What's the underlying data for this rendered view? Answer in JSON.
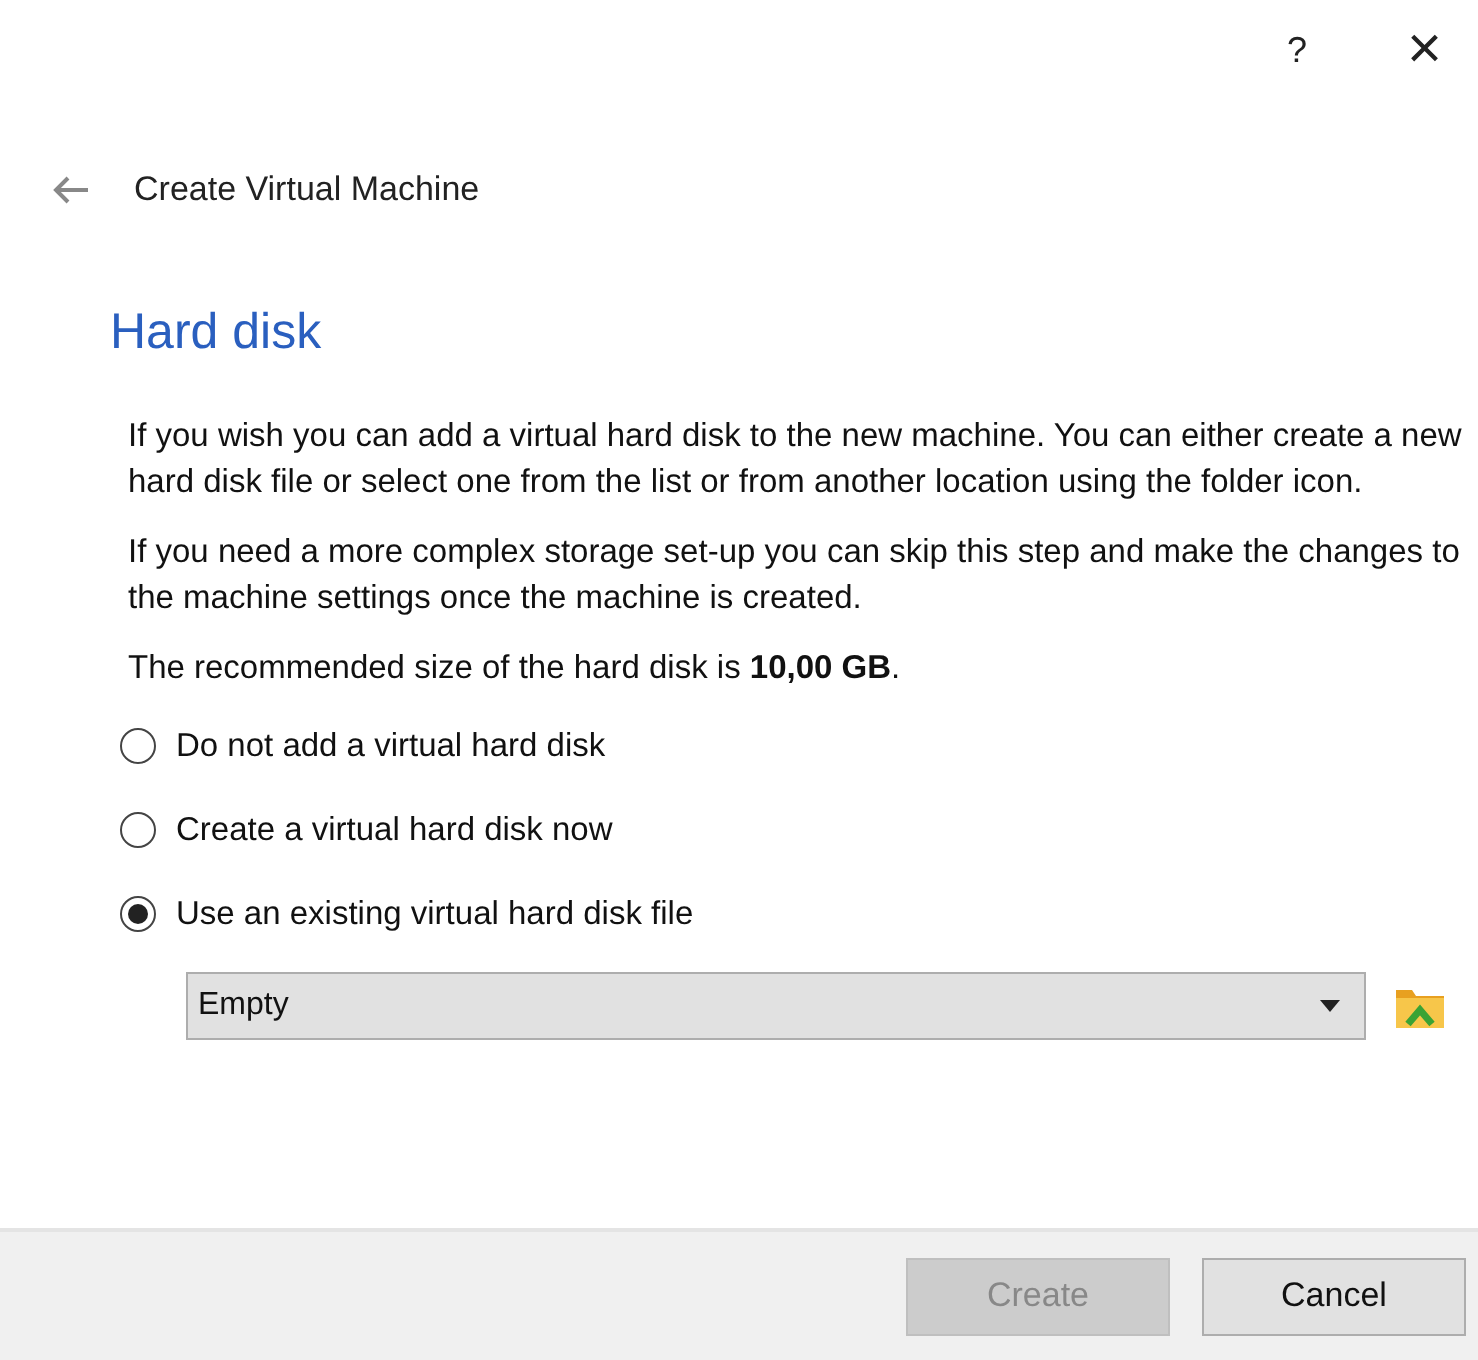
{
  "title_bar": {
    "help": "?",
    "close": "×"
  },
  "header": {
    "title": "Create Virtual Machine"
  },
  "page": {
    "heading": "Hard disk",
    "paragraphs": [
      "If you wish you can add a virtual hard disk to the new machine. You can either create a new hard disk file or select one from the list or from another location using the folder icon.",
      "If you need a more complex storage set-up you can skip this step and make the changes to the machine settings once the machine is created.",
      "The recommended size of the hard disk is **10,00 GB**."
    ],
    "options": [
      {
        "label": "Do not add a virtual hard disk",
        "selected": false
      },
      {
        "label": "Create a virtual hard disk now",
        "selected": false
      },
      {
        "label": "Use an existing virtual hard disk file",
        "selected": true
      }
    ],
    "disk_combo": {
      "value": "Empty"
    }
  },
  "buttons": [
    {
      "label": "Create",
      "disabled": true
    },
    {
      "label": "Cancel",
      "disabled": false
    }
  ]
}
